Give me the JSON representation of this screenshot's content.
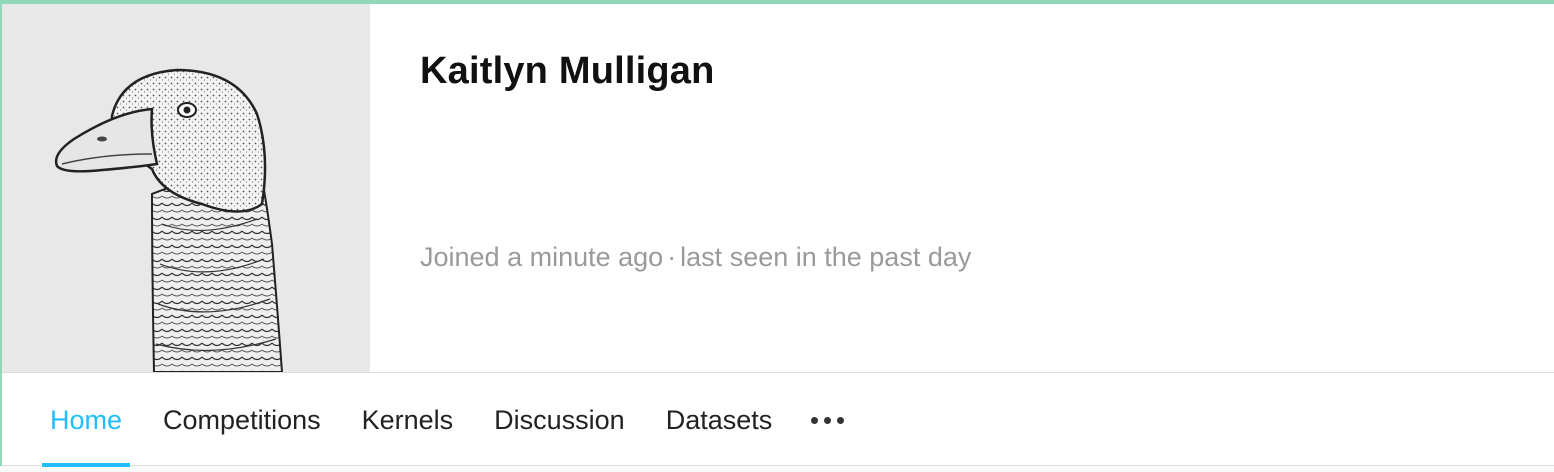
{
  "profile": {
    "name": "Kaitlyn Mulligan",
    "joined": "Joined a minute ago",
    "separator": "·",
    "last_seen": "last seen in the past day"
  },
  "nav": {
    "tabs": [
      {
        "label": "Home",
        "active": true
      },
      {
        "label": "Competitions",
        "active": false
      },
      {
        "label": "Kernels",
        "active": false
      },
      {
        "label": "Discussion",
        "active": false
      },
      {
        "label": "Datasets",
        "active": false
      }
    ],
    "more_icon": "more-horizontal-icon"
  },
  "colors": {
    "accent": "#20beff",
    "card_border": "#90d8b8",
    "avatar_bg": "#e8e8e8",
    "meta_text": "#9a9a9a"
  }
}
